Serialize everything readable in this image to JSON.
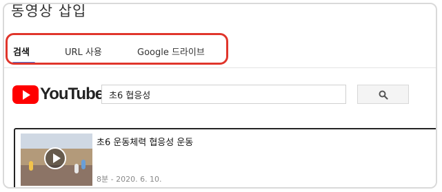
{
  "dialog": {
    "title": "동영상 삽입"
  },
  "tabs": [
    {
      "label": "검색",
      "active": true
    },
    {
      "label": "URL 사용",
      "active": false
    },
    {
      "label": "Google 드라이브",
      "active": false
    }
  ],
  "search": {
    "logo_text": "YouTube",
    "query": "초6 협응성",
    "button_icon": "search-icon"
  },
  "results": [
    {
      "title": "초6 운동체력 협응성 운동",
      "meta": "8분 - 2020. 6. 10."
    }
  ],
  "colors": {
    "highlight": "#e0352b",
    "youtube_red": "#ff0000",
    "tab_underline": "#4a6fd8"
  }
}
